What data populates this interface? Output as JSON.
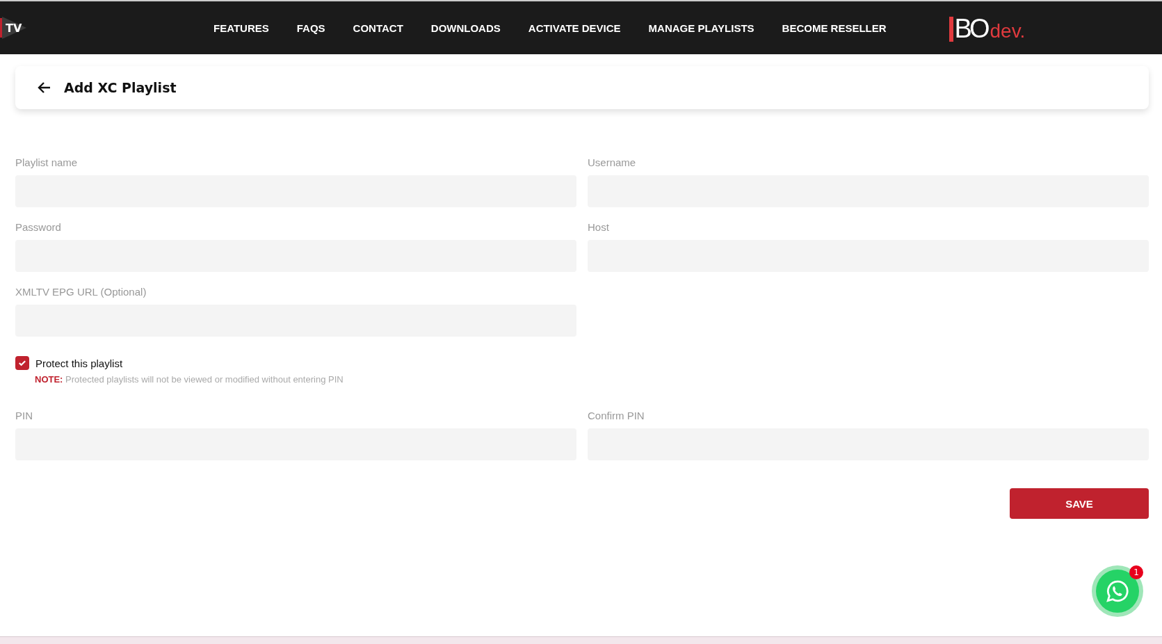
{
  "nav": {
    "brand_left": "TV",
    "links": [
      "FEATURES",
      "FAQS",
      "CONTACT",
      "DOWNLOADS",
      "ACTIVATE DEVICE",
      "MANAGE PLAYLISTS",
      "BECOME RESELLER"
    ],
    "logo": {
      "main": "BO",
      "suffix": "dev."
    }
  },
  "header": {
    "title": "Add XC Playlist"
  },
  "fields": [
    {
      "label": "Playlist name"
    },
    {
      "label": "Username"
    },
    {
      "label": "Password"
    },
    {
      "label": "Host"
    },
    {
      "label": "XMLTV EPG URL (Optional)"
    }
  ],
  "protect": {
    "label": "Protect this playlist",
    "checked": true,
    "note": "**NOTE:** Protected playlists will not be viewed or modified without entering PIN"
  },
  "pin_fields": [
    {
      "label": "PIN"
    },
    {
      "label": "Confirm PIN"
    }
  ],
  "save_button": "SAVE",
  "chat": {
    "badge": "1"
  }
}
